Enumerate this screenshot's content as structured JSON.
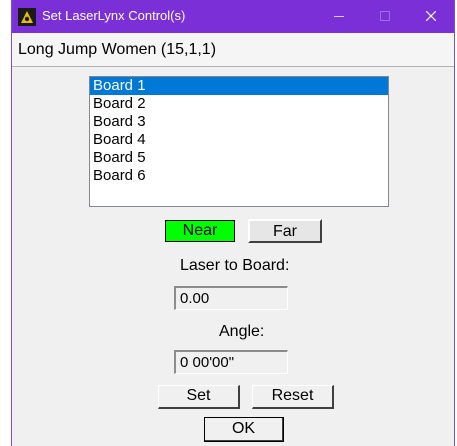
{
  "window": {
    "title": "Set LaserLynx Control(s)",
    "accent_color": "#7b2fd6",
    "icons": [
      "app-icon",
      "minimize-icon",
      "maximize-icon",
      "close-icon"
    ]
  },
  "event": {
    "label": "Long Jump Women (15,1,1)"
  },
  "boards": {
    "selected_index": 0,
    "items": [
      "Board 1",
      "Board 2",
      "Board 3",
      "Board 4",
      "Board 5",
      "Board 6"
    ],
    "selection_color": "#0078d7"
  },
  "mode": {
    "near_label": "Near",
    "far_label": "Far",
    "active": "Near",
    "active_color": "#00ff00"
  },
  "laser_to_board": {
    "label": "Laser to Board:",
    "value": "0.00"
  },
  "angle": {
    "label": "Angle:",
    "value": "0 00'00\""
  },
  "buttons": {
    "set_label": "Set",
    "reset_label": "Reset",
    "ok_label": "OK"
  }
}
